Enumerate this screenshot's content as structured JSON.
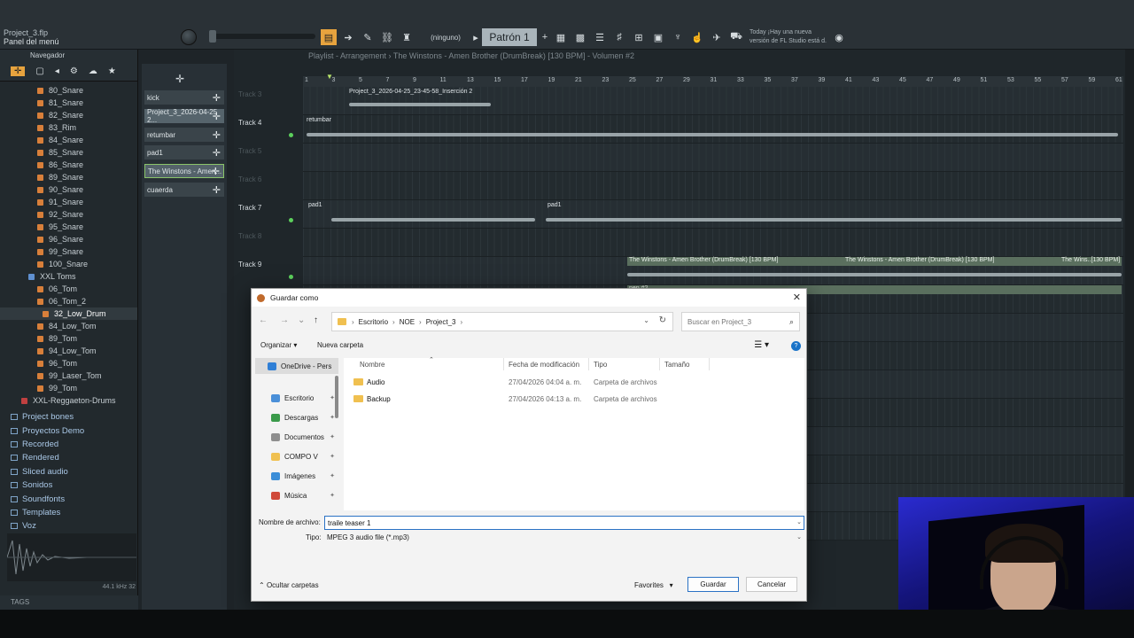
{
  "app": {
    "project_title": "Project_3.flp",
    "panel_menu": "Panel del menú",
    "pattern_none": "(ninguno)",
    "pattern_name": "Patrón 1",
    "hint_line1": "Today  ¡Hay una nueva",
    "hint_line2": "versión de FL Studio está d."
  },
  "browser": {
    "title": "Navegador",
    "items": [
      "80_Snare",
      "81_Snare",
      "82_Snare",
      "83_Rim",
      "84_Snare",
      "85_Snare",
      "86_Snare",
      "89_Snare",
      "90_Snare",
      "91_Snare",
      "92_Snare",
      "95_Snare",
      "96_Snare",
      "99_Snare",
      "100_Snare"
    ],
    "toms_folder": "XXL Toms",
    "toms": [
      "06_Tom",
      "06_Tom_2",
      "32_Low_Drum",
      "84_Low_Tom",
      "89_Tom",
      "94_Low_Tom",
      "96_Tom",
      "99_Laser_Tom",
      "99_Tom"
    ],
    "reggaeton_folder": "XXL-Reggaeton-Drums",
    "folders": [
      "Project bones",
      "Proyectos Demo",
      "Recorded",
      "Rendered",
      "Sliced audio",
      "Sonidos",
      "Soundfonts",
      "Templates",
      "Voz"
    ],
    "sample_rate": "44.1 kHz 32",
    "tags": "TAGS"
  },
  "patterns": [
    "kick",
    "Project_3_2026-04-25 2...",
    "retumbar",
    "pad1",
    "The Winstons - Amen...",
    "cuaerda"
  ],
  "playlist": {
    "title": "Playlist - Arrangement › The Winstons - Amen Brother (DrumBreak) [130 BPM] - Volumen #2",
    "ruler_ticks": [
      "1",
      "3",
      "5",
      "7",
      "9",
      "11",
      "13",
      "15",
      "17",
      "19",
      "21",
      "23",
      "25",
      "27",
      "29",
      "31",
      "33",
      "35",
      "37",
      "39",
      "41",
      "43",
      "45",
      "47",
      "49",
      "51",
      "53",
      "55",
      "57",
      "59",
      "61"
    ],
    "tracks": [
      {
        "label": "Track 3",
        "dim": true
      },
      {
        "label": "Track 4",
        "dim": false
      },
      {
        "label": "Track 5",
        "dim": true
      },
      {
        "label": "Track 6",
        "dim": true
      },
      {
        "label": "Track 7",
        "dim": false
      },
      {
        "label": "Track 8",
        "dim": true
      },
      {
        "label": "Track 9",
        "dim": false
      }
    ],
    "clip_project": "Project_3_2026-04-25_23-45-58_Inserción 2",
    "clip_retumbar": "retumbar",
    "clip_pad1a": "pad1",
    "clip_pad1b": "pad1",
    "clip_amen1": "The Winstons - Amen Brother (DrumBreak) [130 BPM]",
    "clip_amen2": "The Winstons - Amen Brother (DrumBreak) [130 BPM]",
    "clip_amen3": "The Wins..[130 BPM]",
    "clip_amen_vol": "nen #2"
  },
  "dialog": {
    "title": "Guardar como",
    "path": [
      "Escritorio",
      "NOE",
      "Project_3"
    ],
    "search_placeholder": "Buscar en Project_3",
    "organize": "Organizar",
    "new_folder": "Nueva carpeta",
    "nav": [
      {
        "label": "OneDrive - Pers",
        "color": "#2f7fd6"
      },
      {
        "label": "Escritorio",
        "color": "#4a8fd8"
      },
      {
        "label": "Descargas",
        "color": "#3a9a4a"
      },
      {
        "label": "Documentos",
        "color": "#8e8e8e"
      },
      {
        "label": "COMPO V",
        "color": "#f0c050"
      },
      {
        "label": "Imágenes",
        "color": "#3c8ed8"
      },
      {
        "label": "Música",
        "color": "#d04a3a"
      }
    ],
    "columns": {
      "name": "Nombre",
      "date": "Fecha de modificación",
      "type": "Tipo",
      "size": "Tamaño"
    },
    "files": [
      {
        "name": "Audio",
        "date": "27/04/2026 04:04 a. m.",
        "type": "Carpeta de archivos"
      },
      {
        "name": "Backup",
        "date": "27/04/2026 04:13 a. m.",
        "type": "Carpeta de archivos"
      }
    ],
    "filename_label": "Nombre de archivo:",
    "filename_value": "traile teaser 1",
    "type_label": "Tipo:",
    "type_value": "MPEG 3 audio file (*.mp3)",
    "hide_folders": "Ocultar carpetas",
    "favorites": "Favorites",
    "save": "Guardar",
    "cancel": "Cancelar"
  }
}
